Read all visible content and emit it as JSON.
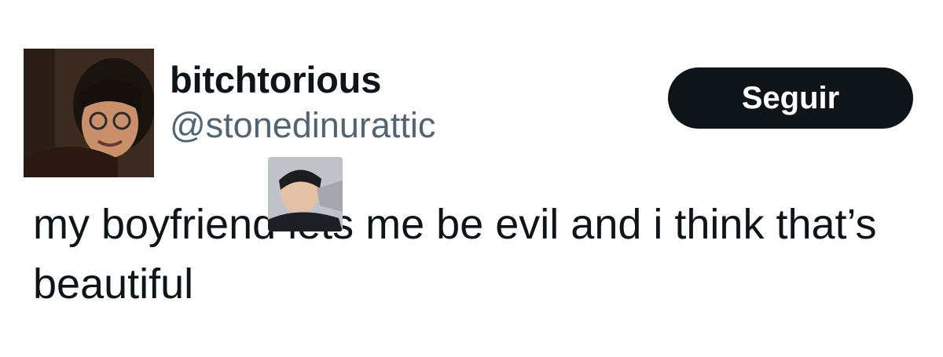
{
  "author": {
    "display_name": "bitchtorious",
    "handle": "@stonedinurattic",
    "avatar_icon": "user-avatar-photo"
  },
  "follow_button": {
    "label": "Seguir",
    "background": "#0f1419",
    "text_color": "#ffffff"
  },
  "tweet": {
    "text": "my boyfriend lets me be evil and i think that’s beautiful"
  },
  "overlay": {
    "icon": "sticker-photo"
  },
  "colors": {
    "primary_text": "#0f1419",
    "secondary_text": "#536471",
    "background": "#ffffff"
  }
}
